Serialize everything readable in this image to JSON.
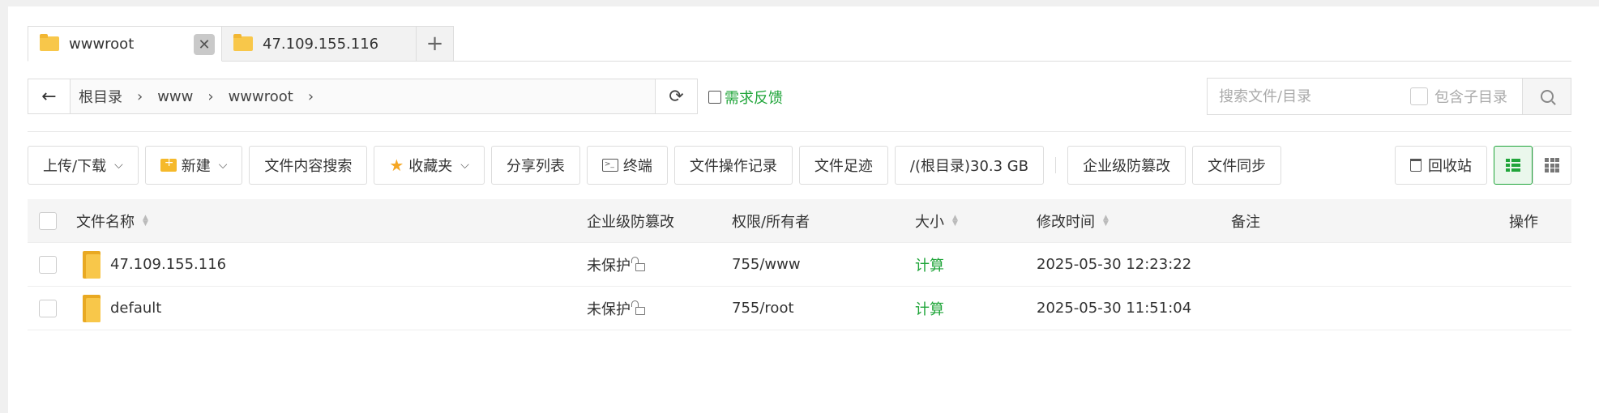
{
  "tabs": [
    {
      "label": "wwwroot",
      "active": true
    },
    {
      "label": "47.109.155.116",
      "active": false
    }
  ],
  "tab_add_label": "+",
  "tab_close_label": "✕",
  "path": {
    "crumbs": [
      "根目录",
      "www",
      "wwwroot"
    ],
    "separator": "›"
  },
  "feedback_label": "需求反馈",
  "search": {
    "placeholder": "搜索文件/目录",
    "include_subdir_label": "包含子目录"
  },
  "toolbar": {
    "upload_label": "上传/下载",
    "new_label": "新建",
    "content_search_label": "文件内容搜索",
    "favorites_label": "收藏夹",
    "share_list_label": "分享列表",
    "terminal_label": "终端",
    "oplog_label": "文件操作记录",
    "footprint_label": "文件足迹",
    "disk_label": "/(根目录)30.3 GB",
    "tamper_label": "企业级防篡改",
    "sync_label": "文件同步",
    "recycle_label": "回收站"
  },
  "table": {
    "headers": {
      "name": "文件名称",
      "protect": "企业级防篡改",
      "perm": "权限/所有者",
      "size": "大小",
      "mtime": "修改时间",
      "note": "备注",
      "ops": "操作"
    },
    "rows": [
      {
        "name": "47.109.155.116",
        "protect": "未保护",
        "perm": "755/www",
        "size": "计算",
        "mtime": "2025-05-30 12:23:22",
        "note": ""
      },
      {
        "name": "default",
        "protect": "未保护",
        "perm": "755/root",
        "size": "计算",
        "mtime": "2025-05-30 11:51:04",
        "note": ""
      }
    ]
  },
  "colors": {
    "accent": "#20a53a",
    "folder": "#f8c74a"
  }
}
